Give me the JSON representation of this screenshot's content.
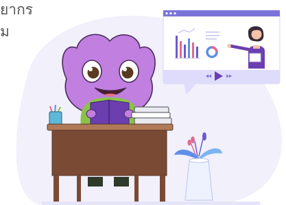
{
  "text": {
    "line1": "ยากร",
    "line2": "ม"
  },
  "icons": {
    "play": "play-icon",
    "rewind": "rewind-icon",
    "fast_forward": "fast-forward-icon"
  },
  "colors": {
    "mascot_body": "#c17fe0",
    "video_frame": "#7b74d8",
    "video_controls": "#dedcfa",
    "play_button": "#6b3fb0",
    "desk": "#7a4a35",
    "backdrop": "#f1f0fb"
  }
}
